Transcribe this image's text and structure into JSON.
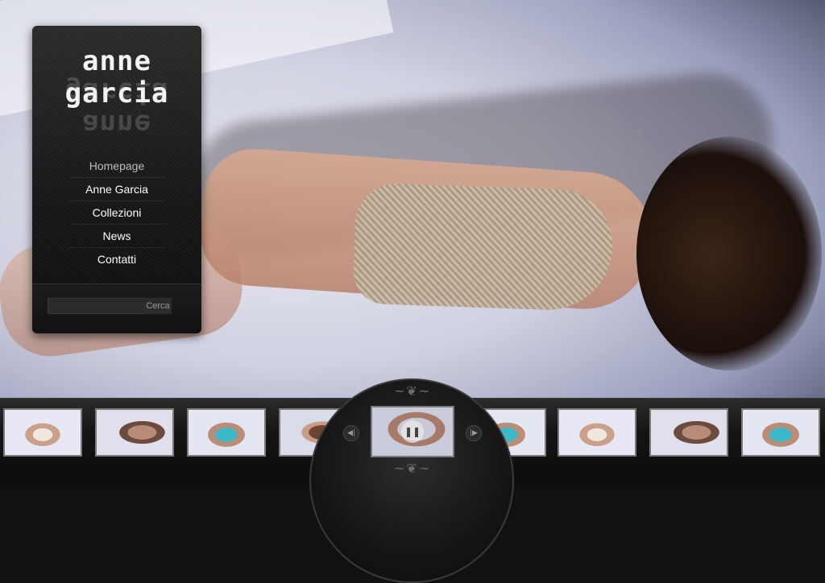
{
  "brand": {
    "title": "anne garcia"
  },
  "menu": {
    "items": [
      {
        "label": "Homepage",
        "active": true
      },
      {
        "label": "Anne Garcia",
        "active": false
      },
      {
        "label": "Collezioni",
        "active": false
      },
      {
        "label": "News",
        "active": false
      },
      {
        "label": "Contatti",
        "active": false
      }
    ]
  },
  "search": {
    "value": "",
    "placeholder": "",
    "button_label": "Cerca"
  },
  "player": {
    "prev_icon": "skip-previous-icon",
    "pause_icon": "pause-icon",
    "next_icon": "skip-next-icon",
    "ornament_icon": "scroll-ornament-icon"
  },
  "colors": {
    "panel": "#1a1a1a",
    "menu_text": "#ffffff",
    "menu_active_text": "#bdbdbd",
    "strip": "#141414",
    "thumb_border": "#7a7a7a"
  }
}
